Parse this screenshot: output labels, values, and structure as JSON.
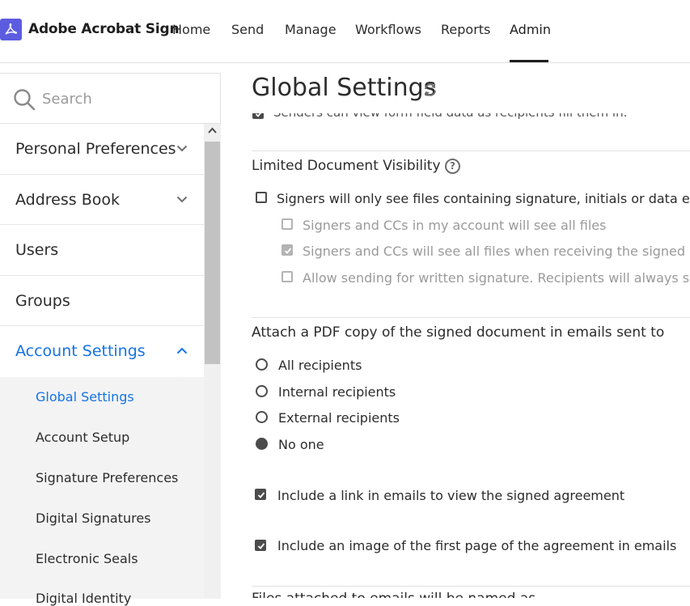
{
  "app": {
    "brand": "Adobe Acrobat Sign",
    "nav": [
      "Home",
      "Send",
      "Manage",
      "Workflows",
      "Reports",
      "Admin"
    ],
    "active_nav": "Admin",
    "accent": "#1473e6",
    "logo_color": "#5c5ce0"
  },
  "sidebar": {
    "search_placeholder": "Search",
    "items": [
      {
        "label": "Personal Preferences",
        "icon": "chevron-down-icon"
      },
      {
        "label": "Address Book",
        "icon": "chevron-down-icon"
      },
      {
        "label": "Users"
      },
      {
        "label": "Groups"
      },
      {
        "label": "Account Settings",
        "icon": "chevron-up-icon",
        "active": true
      }
    ],
    "sub_items": [
      {
        "label": "Global Settings",
        "active": true
      },
      {
        "label": "Account Setup"
      },
      {
        "label": "Signature Preferences"
      },
      {
        "label": "Digital Signatures"
      },
      {
        "label": "Electronic Seals"
      },
      {
        "label": "Digital Identity"
      }
    ]
  },
  "main": {
    "title": "Global Settings",
    "cut_row": "Senders can view form field data as recipients fill them in.",
    "limited_visibility": {
      "title": "Limited Document Visibility",
      "main_option": "Signers will only see files containing signature, initials or data entry fields",
      "sub_options": [
        {
          "label": "Signers and CCs in my account will see all files",
          "checked": false
        },
        {
          "label": "Signers and CCs will see all files when receiving the signed agreement",
          "checked": true
        },
        {
          "label": "Allow sending for written signature. Recipients will always see all files",
          "checked": false
        }
      ]
    },
    "attach_pdf": {
      "title": "Attach a PDF copy of the signed document in emails sent to",
      "options": [
        "All recipients",
        "Internal recipients",
        "External recipients",
        "No one"
      ],
      "selected": "No one"
    },
    "include_link": "Include a link in emails to view the signed agreement",
    "include_image": "Include an image of the first page of the agreement in emails",
    "next_section": "Files attached to emails will be named as"
  }
}
